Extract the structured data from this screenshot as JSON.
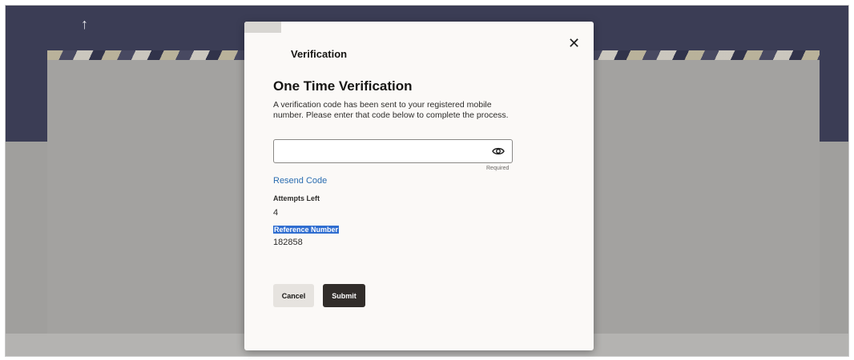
{
  "background": {
    "back_arrow": "↑"
  },
  "modal": {
    "close_glyph": "✕",
    "title": "Verification",
    "heading": "One Time Verification",
    "description": "A verification code has been sent to your registered mobile number. Please enter that code below to complete the process.",
    "otp_input": {
      "value": "",
      "placeholder": "",
      "helper": "Required",
      "icon": "eye-icon"
    },
    "resend_label": "Resend Code",
    "attempts_label": "Attempts Left",
    "attempts_value": "4",
    "reference_label": "Reference Number",
    "reference_value": "182858",
    "buttons": {
      "cancel": "Cancel",
      "submit": "Submit"
    }
  },
  "colors": {
    "header": "#3b3d55",
    "overlay": "#a09f9d",
    "link": "#2a6db0",
    "primary_button": "#312d2a",
    "selection_highlight": "#2f6dd0"
  }
}
